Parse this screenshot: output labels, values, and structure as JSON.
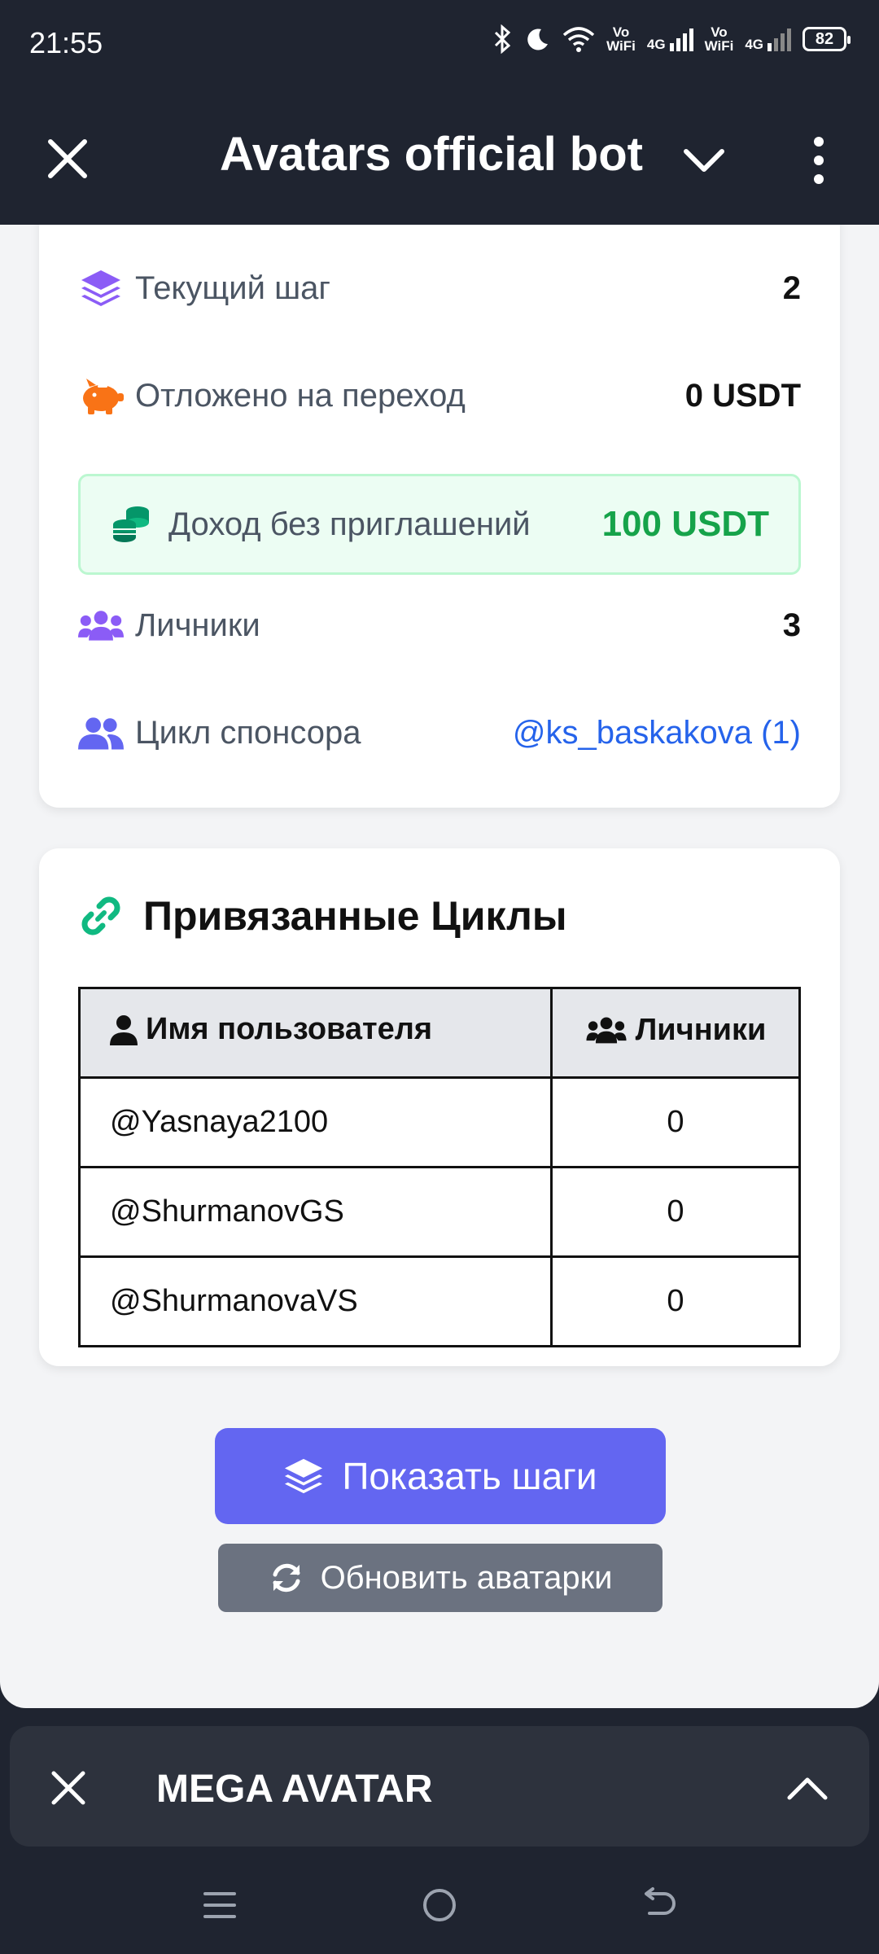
{
  "status_bar": {
    "time": "21:55",
    "net1": "Vo\nWiFi",
    "net1_top": "Vo",
    "net1_bottom": "WiFi",
    "net2": "4G",
    "net3_top": "Vo",
    "net3_bottom": "WiFi",
    "net4": "4G",
    "battery": "82"
  },
  "header": {
    "title": "Avatars official bot"
  },
  "stats": {
    "current_step_label": "Текущий шаг",
    "current_step_value": "2",
    "deferred_label": "Отложено на переход",
    "deferred_value": "0 USDT",
    "income_label": "Доход без приглашений",
    "income_value": "100 USDT",
    "personal_label": "Личники",
    "personal_value": "3",
    "sponsor_label": "Цикл спонсора",
    "sponsor_value": "@ks_baskakova (1)"
  },
  "linked_cycles": {
    "title": "Привязанные Циклы",
    "col_user": "Имя пользователя",
    "col_personal": "Личники",
    "rows": [
      {
        "user": "@Yasnaya2100",
        "personal": "0"
      },
      {
        "user": "@ShurmanovGS",
        "personal": "0"
      },
      {
        "user": "@ShurmanovaVS",
        "personal": "0"
      }
    ]
  },
  "buttons": {
    "show_steps": "Показать шаги",
    "refresh_avatars": "Обновить аватарки"
  },
  "mini_app_bar": {
    "title": "MEGA AVATAR"
  },
  "colors": {
    "accent": "#6366f1",
    "success": "#16a34a",
    "link": "#2563eb",
    "dark_bg": "#1f2430"
  }
}
